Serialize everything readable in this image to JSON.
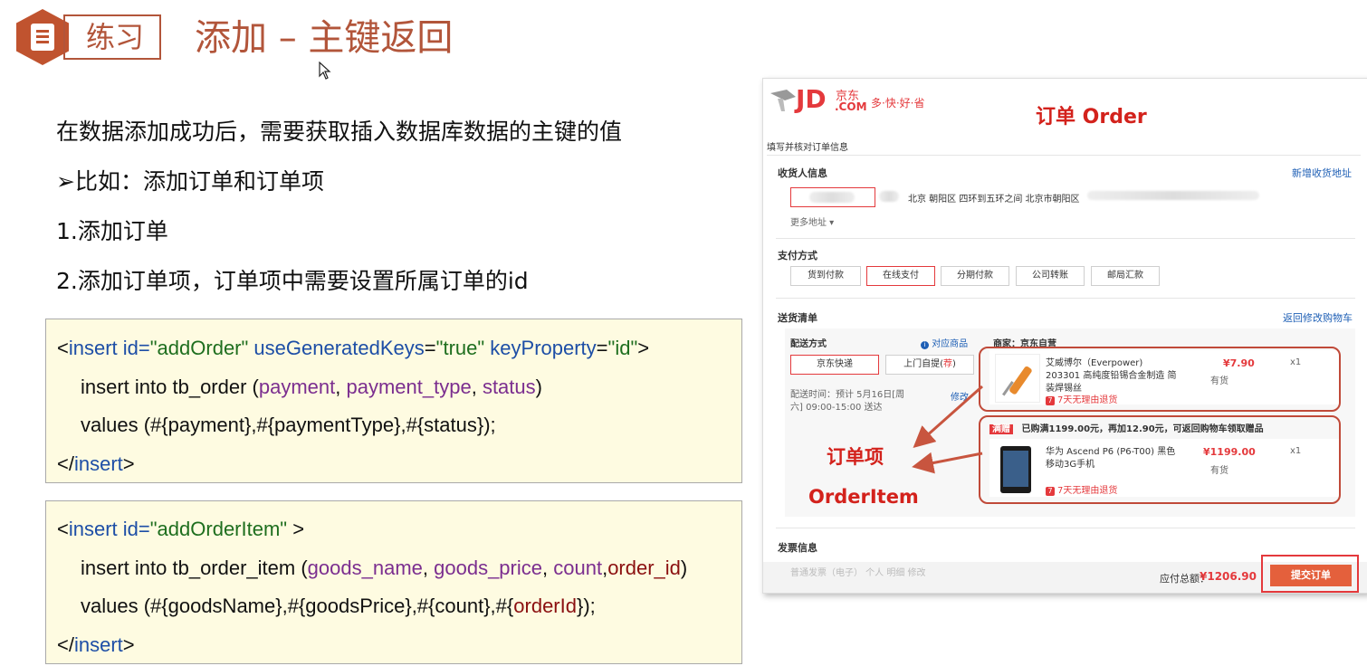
{
  "header": {
    "tag": "练习",
    "title": "添加 – 主键返回"
  },
  "bullets": [
    "在数据添加成功后，需要获取插入数据库数据的主键的值",
    "➢比如：添加订单和订单项",
    "1.添加订单",
    "2.添加订单项，订单项中需要设置所属订单的id"
  ],
  "code1": {
    "open_lt": "<",
    "open_tag": "insert",
    "attr1": " id=",
    "val1": "\"addOrder\"",
    "attr2": " useGeneratedKeys",
    "eq2": "=",
    "val2": "\"true\"",
    "attr3": " keyProperty",
    "eq3": "=",
    "val3": "\"id\"",
    "open_gt": ">",
    "l2_a": "insert into tb_order (",
    "l2_p1": "payment",
    "l2_c1": ", ",
    "l2_p2": "payment_type",
    "l2_c2": ", ",
    "l2_p3": "status",
    "l2_end": ")",
    "l3": "values (#{payment},#{paymentType},#{status});",
    "close_lt": "</",
    "close_tag": "insert",
    "close_gt": ">"
  },
  "code2": {
    "open_lt": "<",
    "open_tag": "insert",
    "attr1": " id=",
    "val1": "\"addOrderItem\"",
    "open_gt": " >",
    "l2_a": "insert into tb_order_item (",
    "l2_p1": "goods_name",
    "l2_c1": ", ",
    "l2_p2": "goods_price",
    "l2_c2": ", ",
    "l2_p3": "count",
    "l2_c3": ",",
    "l2_p4": "order_id",
    "l2_end": ")",
    "l3_a": "values (#{goodsName},#{goodsPrice},#{count},#{",
    "l3_b": "orderId",
    "l3_c": "});",
    "close_lt": "</",
    "close_tag": "insert",
    "close_gt": ">"
  },
  "jd": {
    "logo": "JD",
    "logo_cn": "京东",
    "logo_com": ".COM",
    "slogan": "多·快·好·省",
    "order_label": "订单 Order",
    "fill_title": "填写并核对订单信息",
    "recv_title": "收货人信息",
    "add_addr": "新增收货地址",
    "addr": "北京 朝阳区 四环到五环之间 北京市朝阳区",
    "more_addr": "更多地址 ▾",
    "pay_title": "支付方式",
    "pay_opts": [
      "货到付款",
      "在线支付",
      "分期付款",
      "公司转账",
      "邮局汇款"
    ],
    "ship_title": "送货清单",
    "back_cart": "返回修改购物车",
    "delivery": "配送方式",
    "match": "对应商品",
    "seller": "商家：京东自营",
    "jd_express": "京东快递",
    "pickup": "上门自提",
    "pickup_tag": "荐",
    "ship_time": "配送时间：预计 5月16日[周六] 09:00-15:00 送达",
    "modify": "修改",
    "item1_name": "艾威博尔（Everpower) 203301 高纯度铅锡合金制造 简装焊锡丝",
    "item1_price": "¥7.90",
    "item1_stock": "有货",
    "item1_qty": "x1",
    "return7": "7天无理由退货",
    "promo_tag": "满赠",
    "promo": "已购满1199.00元，再加12.90元，可返回购物车领取赠品",
    "item2_name": "华为 Ascend P6 (P6-T00) 黑色 移动3G手机",
    "item2_price": "¥1199.00",
    "item2_stock": "有货",
    "item2_qty": "x1",
    "orderitem_cn": "订单项",
    "orderitem_en": "OrderItem",
    "invoice_title": "发票信息",
    "invoice_row": "普通发票（电子） 个人 明细 修改",
    "total_label": "应付总额：",
    "total": "¥1206.90",
    "submit": "提交订单"
  }
}
